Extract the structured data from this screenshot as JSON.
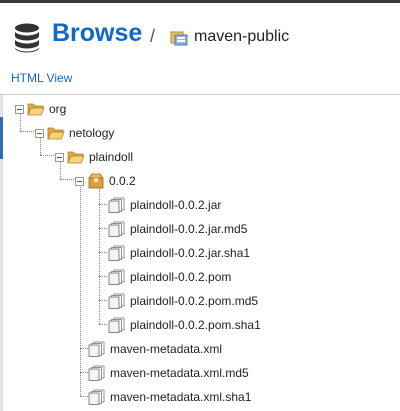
{
  "header": {
    "title": "Browse",
    "separator": "/",
    "repository": "maven-public",
    "db_icon": "database-icon",
    "repo_icon": "repository-icon"
  },
  "html_view_link": "HTML View",
  "colors": {
    "accent": "#1168c6",
    "folder": "#f2c05a",
    "package": "#d9a040"
  },
  "tree": {
    "org": "org",
    "netology": "netology",
    "plaindoll": "plaindoll",
    "version": "0.0.2",
    "files": [
      "plaindoll-0.0.2.jar",
      "plaindoll-0.0.2.jar.md5",
      "plaindoll-0.0.2.jar.sha1",
      "plaindoll-0.0.2.pom",
      "plaindoll-0.0.2.pom.md5",
      "plaindoll-0.0.2.pom.sha1"
    ],
    "metadata": [
      "maven-metadata.xml",
      "maven-metadata.xml.md5",
      "maven-metadata.xml.sha1"
    ]
  }
}
